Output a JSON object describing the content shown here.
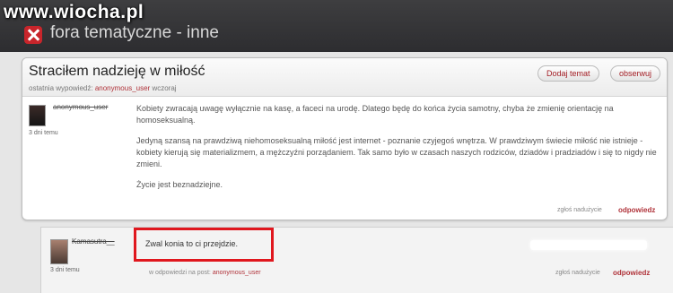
{
  "watermark": "www.wiocha.pl",
  "header": {
    "forum_title": "fora tematyczne - inne"
  },
  "thread": {
    "title": "Straciłem nadzieję w miłość",
    "last_reply_label": "ostatnia wypowiedź:",
    "last_reply_user": "anonymous_user",
    "last_reply_time": "wczoraj",
    "new_topic_label": "Dodaj temat",
    "watch_label": "obserwuj"
  },
  "post": {
    "author": "anonymous_user",
    "date": "3 dni temu",
    "paragraphs": [
      "Kobiety zwracają uwagę wyłącznie na kasę, a faceci na urodę. Dlatego będę do końca życia samotny, chyba że zmienię orientację na homoseksualną.",
      "Jedyną szansą na prawdziwą niehomoseksualną miłość jest internet - poznanie czyjegoś wnętrza. W prawdziwym świecie miłość nie istnieje - kobiety kierują się materializmem, a mężczyźni porządaniem. Tak samo było w czasach naszych rodziców, dziadów i pradziadów i się to nigdy nie zmieni.",
      "Życie jest beznadziejne."
    ],
    "report_label": "zgłoś nadużycie",
    "reply_label": "odpowiedz"
  },
  "reply": {
    "author": "Kamasutra__",
    "date": "3 dni temu",
    "text": "Zwal konia to ci przejdzie.",
    "in_reply_label": "w odpowiedzi na post:",
    "in_reply_user": "anonymous_user",
    "report_label": "zgłoś nadużycie",
    "reply_label": "odpowiedz"
  },
  "colors": {
    "accent": "#b0333a",
    "highlight": "#e0171e",
    "topbar": "#333336"
  }
}
